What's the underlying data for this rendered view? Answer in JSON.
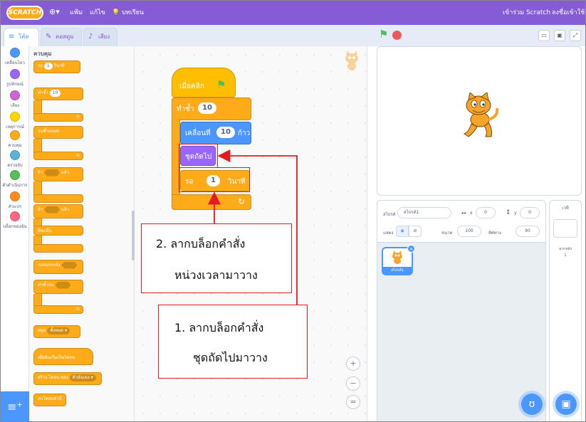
{
  "menu": {
    "logo": "SCRATCH",
    "globe": "⊕▾",
    "file": "แฟ้ม",
    "edit": "แก้ไข",
    "tutorials": "บทเรียน",
    "join": "เข้าร่วม Scratch",
    "signin": "ลงชื่อเข้าใช้"
  },
  "tabs": {
    "code": "โค้ด",
    "costumes": "คอสตูม",
    "sounds": "เสียง"
  },
  "categories": [
    {
      "label": "เคลื่อนไหว",
      "color": "#4c97ff"
    },
    {
      "label": "รูปลักษณ์",
      "color": "#9966ff"
    },
    {
      "label": "เสียง",
      "color": "#cf63cf"
    },
    {
      "label": "เหตุการณ์",
      "color": "#ffd500"
    },
    {
      "label": "ควบคุม",
      "color": "#ffab19"
    },
    {
      "label": "ตรวจจับ",
      "color": "#5cb1d6"
    },
    {
      "label": "ตัวดำเนินการ",
      "color": "#59c059"
    },
    {
      "label": "ตัวแปร",
      "color": "#ff8c1a"
    },
    {
      "label": "บล็อกของฉัน",
      "color": "#ff6680"
    }
  ],
  "palette": {
    "heading": "ควบคุม",
    "wait": {
      "label": "รอ",
      "value": "1",
      "unit": "วินาที"
    },
    "repeat": {
      "label": "ทำซ้ำ",
      "value": "10"
    },
    "forever": "วนซ้ำตลอด",
    "if_then": {
      "if": "ถ้า",
      "then": "แล้ว"
    },
    "if_else": {
      "if": "ถ้า",
      "then": "แล้ว",
      "else": "มิฉะนั้น"
    },
    "wait_until": "รอจนกระทั่ง",
    "repeat_until": "ทำซ้ำจน",
    "stop": {
      "label": "หยุด",
      "option": "ทั้งหมด ▾"
    },
    "clone_start": "เมื่อฉันเริ่มเป็นโคลน",
    "create_clone": {
      "label": "สร้าง โคลน ของ",
      "option": "ตัวฉันเอง ▾"
    },
    "delete_clone": "ลบโคลนตัวนี้"
  },
  "script": {
    "hat": "เมื่อคลิก",
    "repeat": {
      "label": "ทำซ้ำ",
      "value": "10"
    },
    "move": {
      "label": "เคลื่อนที่",
      "value": "10",
      "unit": "ก้าว"
    },
    "next_costume": "ชุดถัดไป",
    "wait": {
      "label": "รอ",
      "value": "1",
      "unit": "วินาที"
    }
  },
  "zoom": {
    "in": "+",
    "out": "−",
    "reset": "="
  },
  "sprite_info": {
    "sprite_label": "สไปรต์",
    "sprite_name": "สไปรต์1",
    "x_label": "x",
    "x_value": "0",
    "y_label": "y",
    "y_value": "0",
    "show_label": "แสดง",
    "size_label": "ขนาด",
    "size_value": "100",
    "direction_label": "ทิศทาง",
    "direction_value": "90"
  },
  "sprite_card": "สไปรต์1",
  "stage_panel": {
    "title": "เวที",
    "backdrops_label": "ฉากหลัง",
    "backdrops_count": "1"
  },
  "annotations": {
    "step2_line1": "2.  ลากบล็อกคำสั่ง",
    "step2_line2": "หน่วงเวลามาวาง",
    "step1_line1": "1.  ลากบล็อกคำสั่ง",
    "step1_line2": "ชุดถัดไปมาวาง"
  },
  "colors": {
    "accent": "#855cd6",
    "blue": "#4c97ff",
    "control": "#ffab19",
    "annotation": "#e21b22"
  }
}
